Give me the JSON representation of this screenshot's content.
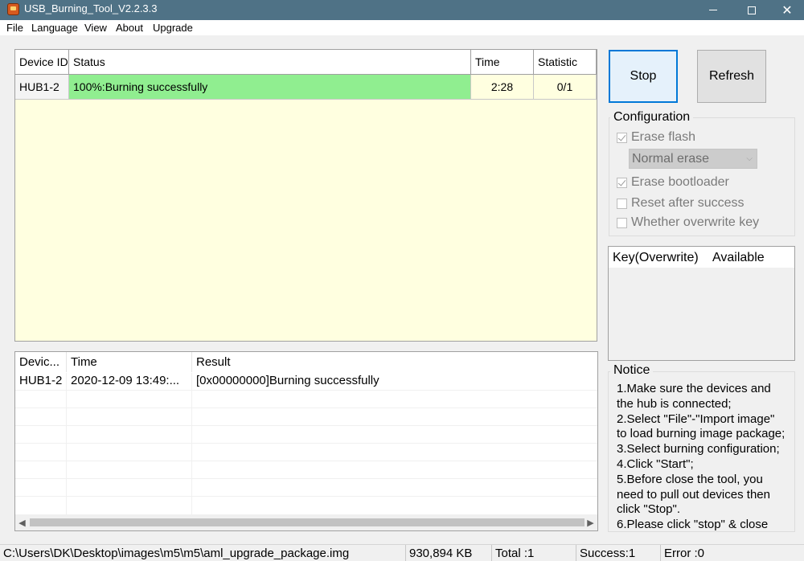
{
  "window": {
    "title": "USB_Burning_Tool_V2.2.3.3",
    "min_icon": "minimize-icon",
    "max_icon": "maximize-icon",
    "close_glyph": "✕"
  },
  "menu": [
    "File",
    "Language",
    "View",
    "About",
    "Upgrade"
  ],
  "device_grid": {
    "headers": [
      "Device ID",
      "Status",
      "Time",
      "Statistic"
    ],
    "rows": [
      {
        "device_id": "HUB1-2",
        "status": "100%:Burning successfully",
        "time": "2:28",
        "statistic": "0/1"
      }
    ],
    "status_color": "#90ee90",
    "background": "#ffffe0"
  },
  "log": {
    "headers": [
      "Devic...",
      "Time",
      "Result"
    ],
    "rows": [
      {
        "device": "HUB1-2",
        "time": "2020-12-09 13:49:...",
        "result": "[0x00000000]Burning successfully"
      }
    ]
  },
  "buttons": {
    "stop": "Stop",
    "refresh": "Refresh"
  },
  "configuration": {
    "title": "Configuration",
    "erase_flash": {
      "label": "Erase flash",
      "checked": true
    },
    "erase_mode": "Normal erase",
    "erase_bootloader": {
      "label": "Erase bootloader",
      "checked": true
    },
    "reset_after_success": {
      "label": "Reset after success",
      "checked": false
    },
    "overwrite_key": {
      "label": "Whether overwrite key",
      "checked": false
    }
  },
  "key_list": {
    "headers": [
      "Key(Overwrite)",
      "Available"
    ]
  },
  "notice": {
    "title": "Notice",
    "lines": [
      "1.Make sure the devices and",
      "the hub is connected;",
      "2.Select \"File\"-\"Import image\"",
      "to load burning image package;",
      "3.Select burning configuration;",
      "4.Click \"Start\";",
      "5.Before close the tool, you",
      "need to pull out devices then",
      "click \"Stop\".",
      "6.Please click \"stop\" & close"
    ]
  },
  "status_bar": {
    "path": "C:\\Users\\DK\\Desktop\\images\\m5\\m5\\aml_upgrade_package.img",
    "size": "930,894 KB",
    "total": "Total :1",
    "success": "Success:1",
    "error": "Error :0"
  }
}
